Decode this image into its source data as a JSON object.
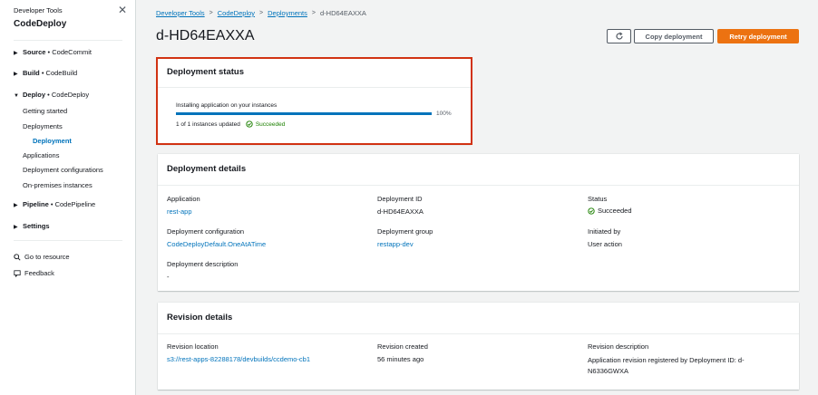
{
  "sidebar": {
    "service_group": "Developer Tools",
    "service_name": "CodeDeploy",
    "sections": {
      "source": {
        "name": "Source",
        "sub": "CodeCommit"
      },
      "build": {
        "name": "Build",
        "sub": "CodeBuild"
      },
      "deploy": {
        "name": "Deploy",
        "sub": "CodeDeploy"
      },
      "pipeline": {
        "name": "Pipeline",
        "sub": "CodePipeline"
      },
      "settings": {
        "name": "Settings"
      }
    },
    "deploy_items": {
      "getting_started": "Getting started",
      "deployments": "Deployments",
      "deployment": "Deployment",
      "applications": "Applications",
      "deployment_configurations": "Deployment configurations",
      "on_premises": "On-premises instances"
    },
    "go_to_resource": "Go to resource",
    "feedback": "Feedback"
  },
  "breadcrumb": [
    "Developer Tools",
    "CodeDeploy",
    "Deployments",
    "d-HD64EAXXA"
  ],
  "page_title": "d-HD64EAXXA",
  "actions": {
    "copy": "Copy deployment",
    "retry": "Retry deployment"
  },
  "deployment_status": {
    "title": "Deployment status",
    "progress_label": "Installing application on your instances",
    "progress_percent": 100,
    "progress_text": "100%",
    "instances_text": "1 of 1 instances updated",
    "status": "Succeeded"
  },
  "deployment_details": {
    "title": "Deployment details",
    "application_label": "Application",
    "application": "rest-app",
    "deployment_id_label": "Deployment ID",
    "deployment_id": "d-HD64EAXXA",
    "status_label": "Status",
    "status": "Succeeded",
    "config_label": "Deployment configuration",
    "config": "CodeDeployDefault.OneAtATime",
    "group_label": "Deployment group",
    "group": "restapp-dev",
    "initiated_label": "Initiated by",
    "initiated": "User action",
    "description_label": "Deployment description",
    "description": "-"
  },
  "revision_details": {
    "title": "Revision details",
    "location_label": "Revision location",
    "location": "s3://rest-apps-82288178/devbuilds/ccdemo-cb1",
    "created_label": "Revision created",
    "created": "56 minutes ago",
    "description_label": "Revision description",
    "description_line1": "Application revision registered by Deployment ID: d-",
    "description_line2": "N6336GWXA"
  },
  "colors": {
    "accent": "#0073bb",
    "primary_button": "#ec7211",
    "success": "#1d8102",
    "highlight": "#d13212"
  }
}
